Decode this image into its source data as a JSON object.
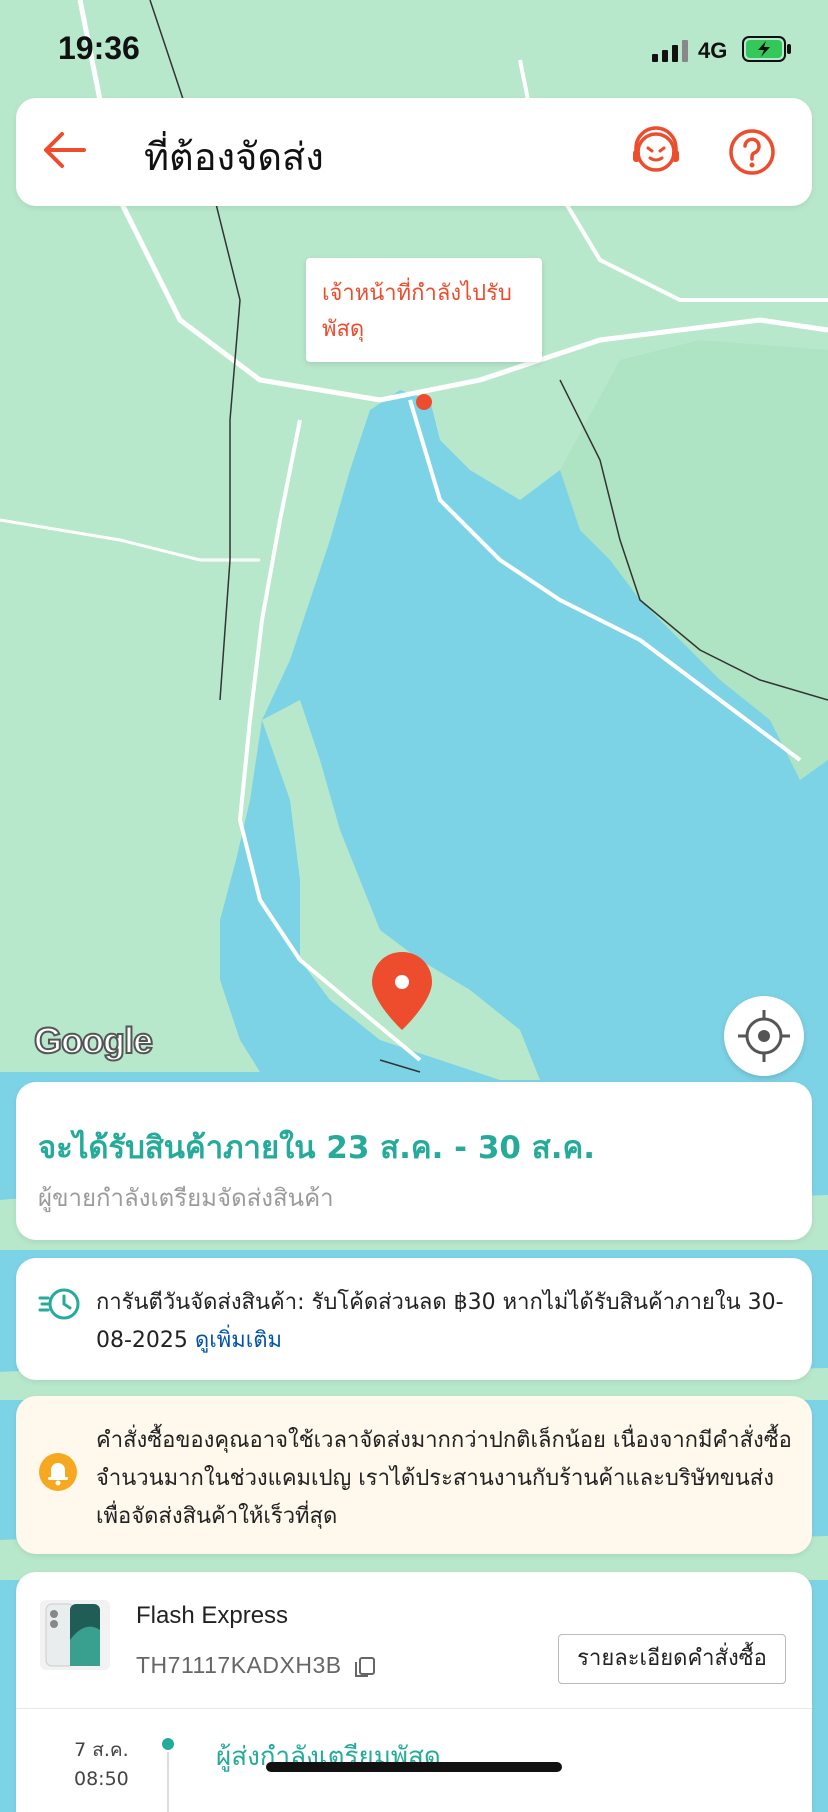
{
  "status_bar": {
    "time": "19:36",
    "network": "4G"
  },
  "header": {
    "title": "ที่ต้องจัดส่ง"
  },
  "map": {
    "tooltip": "เจ้าหน้าที่กำลังไปรับพัสดุ",
    "attribution": "Google",
    "colors": {
      "water": "#7dd3e6",
      "land": "#b8e8cc",
      "accent": "#ee4d2d"
    }
  },
  "eta": {
    "main": "จะได้รับสินค้าภายใน 23 ส.ค. - 30 ส.ค.",
    "sub": "ผู้ขายกำลังเตรียมจัดส่งสินค้า"
  },
  "guarantee": {
    "text": "การันตีวันจัดส่งสินค้า: รับโค้ดส่วนลด ฿30 หากไม่ได้รับสินค้าภายใน 30-08-2025",
    "link": "ดูเพิ่มเติม"
  },
  "notice": {
    "text": "คำสั่งซื้อของคุณอาจใช้เวลาจัดส่งมากกว่าปกติเล็กน้อย เนื่องจากมีคำสั่งซื้อจำนวนมากในช่วงแคมเปญ เราได้ประสานงานกับร้านค้าและบริษัทขนส่งเพื่อจัดส่งสินค้าให้เร็วที่สุด"
  },
  "shipment": {
    "carrier": "Flash Express",
    "tracking": "TH71117KADXH3B",
    "details_button": "รายละเอียดคำสั่งซื้อ",
    "events": [
      {
        "date": "7 ส.ค.",
        "time": "08:50",
        "label": "ผู้ส่งกำลังเตรียมพัสดุ"
      }
    ]
  }
}
